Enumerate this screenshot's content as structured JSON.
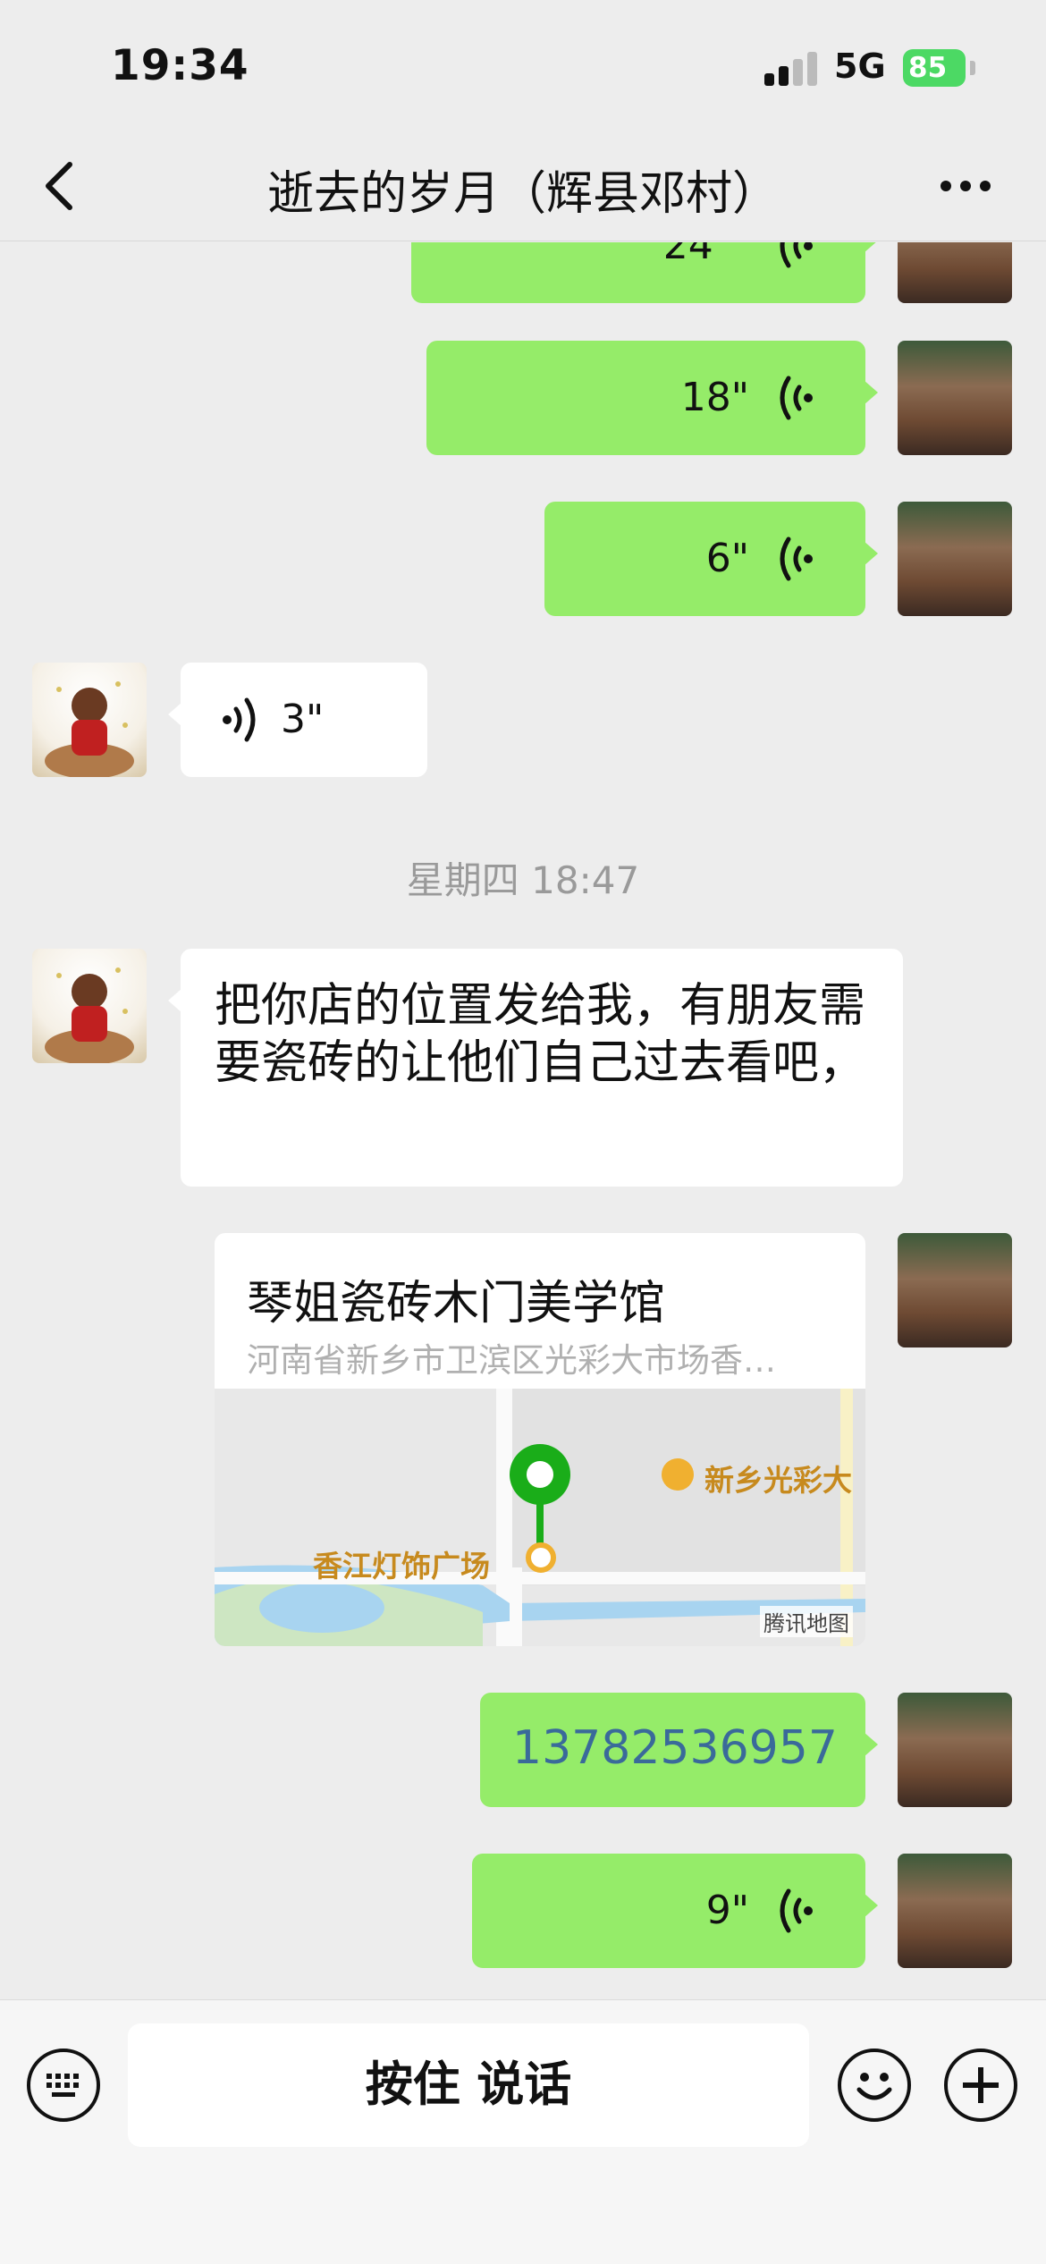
{
  "status_bar": {
    "time": "19:34",
    "network": "5G",
    "battery": "85"
  },
  "header": {
    "title": "逝去的岁月（辉县邓村）"
  },
  "messages": {
    "voice_top_partial": "24\"",
    "voice_1": "18\"",
    "voice_2": "6\"",
    "voice_3": "3\"",
    "timestamp": "星期四 18:47",
    "text_msg": "把你店的位置发给我，有朋友需要瓷砖的让他们自己过去看吧，",
    "location": {
      "name": "琴姐瓷砖木门美学馆",
      "address": "河南省新乡市卫滨区光彩大市场香…",
      "map_labels": [
        "新乡光彩大",
        "香江灯饰广场"
      ],
      "map_credit": "腾讯地图"
    },
    "phone": "13782536957",
    "voice_4": "9\""
  },
  "input_bar": {
    "hold_to_talk": "按住 说话"
  },
  "icons": [
    "back-arrow-icon",
    "more-dots-icon",
    "voice-wave-icon",
    "keyboard-icon",
    "emoji-icon",
    "plus-icon",
    "map-pin-icon"
  ],
  "colors": {
    "outgoing_bubble": "#95ec69",
    "incoming_bubble": "#ffffff",
    "background": "#ededed",
    "map_pin": "#1aad19"
  }
}
